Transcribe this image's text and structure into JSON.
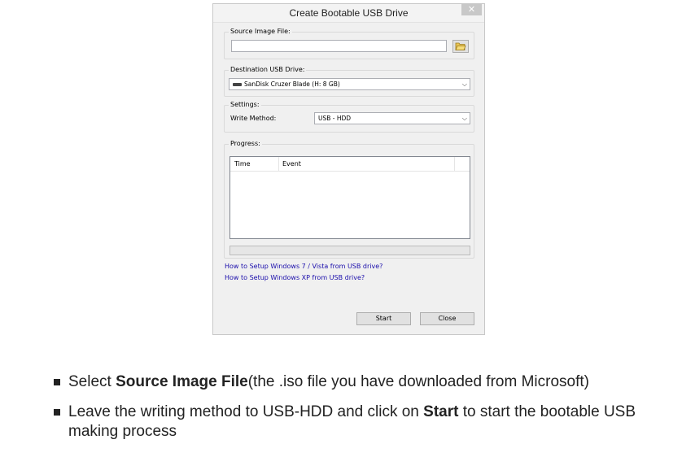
{
  "window": {
    "title": "Create Bootable USB Drive",
    "close_glyph": "✕"
  },
  "source": {
    "legend": "Source Image File:",
    "value": ""
  },
  "destination": {
    "legend": "Destination USB Drive:",
    "selected": "SanDisk Cruzer Blade (H: 8 GB)"
  },
  "settings": {
    "legend": "Settings:",
    "write_method_label": "Write Method:",
    "write_method_value": "USB - HDD"
  },
  "progress": {
    "legend": "Progress:",
    "columns": [
      "Time",
      "Event"
    ],
    "percent": 0
  },
  "links": [
    "How to Setup Windows 7 / Vista from USB drive?",
    "How to Setup Windows XP from USB drive?"
  ],
  "buttons": {
    "start": "Start",
    "close": "Close"
  },
  "instructions": [
    {
      "prefix": "Select ",
      "bold": "Source Image File",
      "suffix": "(the .iso file you have downloaded from Microsoft)"
    },
    {
      "prefix": "Leave the writing method to USB-HDD and click on ",
      "bold": "Start",
      "suffix": " to start the bootable USB making process"
    }
  ],
  "icons": {
    "folder": "folder-open-icon",
    "drive": "usb-drive-icon",
    "dropdown": "chevron-down-icon",
    "bullet": "square-bullet-icon"
  },
  "colors": {
    "window_bg": "#f0f0f0",
    "link": "#1a0dab",
    "button_bg": "#e1e1e1",
    "close_button_bg": "#c8c8c8"
  }
}
